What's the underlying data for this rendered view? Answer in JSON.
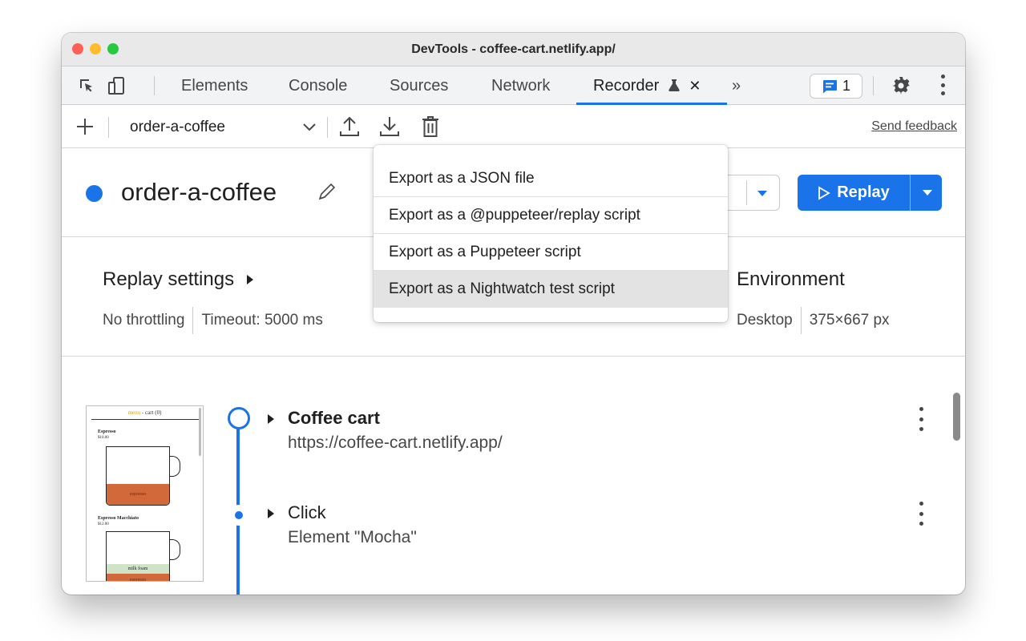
{
  "window": {
    "title": "DevTools - coffee-cart.netlify.app/"
  },
  "tabs": [
    {
      "label": "Elements"
    },
    {
      "label": "Console"
    },
    {
      "label": "Sources"
    },
    {
      "label": "Network"
    },
    {
      "label": "Recorder"
    }
  ],
  "tab_overflow": "»",
  "issues_badge": {
    "count": "1"
  },
  "toolbar": {
    "recording_name": "order-a-coffee",
    "send_feedback": "Send feedback"
  },
  "recording": {
    "title": "order-a-coffee",
    "replay_label": "Replay"
  },
  "settings": {
    "replay_heading": "Replay settings",
    "throttling": "No throttling",
    "timeout": "Timeout: 5000 ms",
    "environment_heading": "Environment",
    "device": "Desktop",
    "viewport": "375×667 px"
  },
  "export_menu": {
    "items": [
      "Export as a JSON file",
      "Export as a @puppeteer/replay script",
      "Export as a Puppeteer script",
      "Export as a Nightwatch test script"
    ],
    "hovered_index": 3
  },
  "steps": [
    {
      "title": "Coffee cart",
      "subtitle": "https://coffee-cart.netlify.app/"
    },
    {
      "title": "Click",
      "subtitle": "Element \"Mocha\""
    }
  ],
  "thumbnail": {
    "nav_menu": "menu",
    "nav_cart": "cart (0)",
    "item1_name": "Espresso",
    "item1_price": "$10.00",
    "item1_fill": "espresso",
    "item2_name": "Espresso Macchiato",
    "item2_price": "$12.00",
    "item2_foam": "milk foam",
    "item2_fill": "espresso"
  },
  "colors": {
    "accent": "#1a73e8",
    "coffee": "#d2693b",
    "foam": "#cfe4c7"
  }
}
